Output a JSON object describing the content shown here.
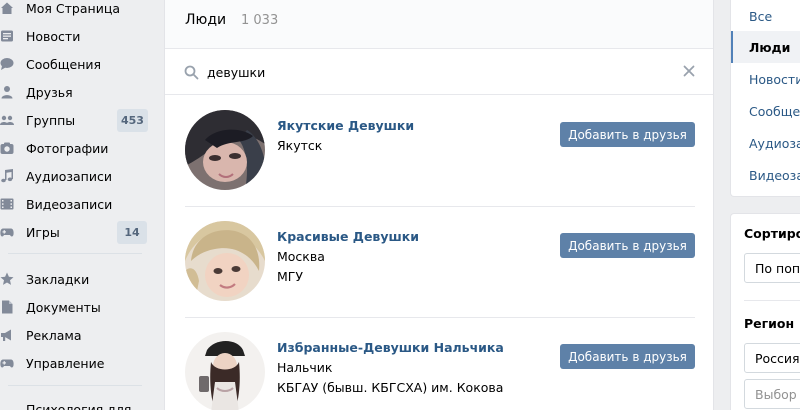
{
  "sidebar": {
    "items": [
      {
        "label": "Моя Страница",
        "icon": "home-icon"
      },
      {
        "label": "Новости",
        "icon": "news-icon"
      },
      {
        "label": "Сообщения",
        "icon": "messages-icon"
      },
      {
        "label": "Друзья",
        "icon": "friends-icon"
      },
      {
        "label": "Группы",
        "icon": "groups-icon",
        "count": "453"
      },
      {
        "label": "Фотографии",
        "icon": "camera-icon"
      },
      {
        "label": "Аудиозаписи",
        "icon": "music-icon"
      },
      {
        "label": "Видеозаписи",
        "icon": "video-icon"
      },
      {
        "label": "Игры",
        "icon": "gamepad-icon",
        "count": "14"
      },
      {
        "label": "Закладки",
        "icon": "star-icon"
      },
      {
        "label": "Документы",
        "icon": "document-icon"
      },
      {
        "label": "Реклама",
        "icon": "megaphone-icon"
      },
      {
        "label": "Управление",
        "icon": "gamepad-icon"
      },
      {
        "label": "Психология для",
        "icon": ""
      }
    ]
  },
  "main": {
    "title": "Люди",
    "count": "1 033",
    "search": {
      "value": "девушки",
      "icon": "search-icon",
      "clear_icon": "close-icon"
    },
    "add_button_label": "Добавить в друзья",
    "people": [
      {
        "name": "Якутские Девушки",
        "line1": "Якутск",
        "line2": ""
      },
      {
        "name": "Красивые Девушки",
        "line1": "Москва",
        "line2": "МГУ"
      },
      {
        "name": "Избранные-Девушки Нальчика",
        "line1": "Нальчик",
        "line2": "КБГАУ (бывш. КБГСХА) им. Кокова"
      }
    ]
  },
  "filters": {
    "sections": [
      "Все",
      "Люди",
      "Новости",
      "Сообщества",
      "Аудиозаписи",
      "Видеозаписи"
    ],
    "active": "Люди",
    "sort_label": "Сортировка",
    "sort_value": "По популярности",
    "region_label": "Регион",
    "region_value": "Россия",
    "city_placeholder": "Выбор города"
  },
  "colors": {
    "background": "#edeef0",
    "link": "#2a5885",
    "button": "#5e81a8",
    "counter_bg": "#dae1e8",
    "counter_text": "#55677d"
  }
}
